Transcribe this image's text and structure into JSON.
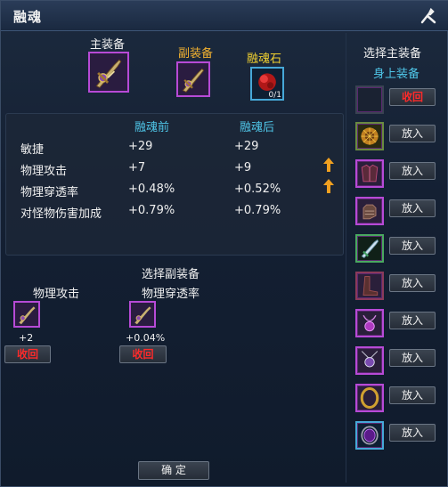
{
  "window": {
    "title": "融魂"
  },
  "top": {
    "main_label": "主装备",
    "sub_label": "副装备",
    "stone_label": "融魂石",
    "stone_count": "0/1"
  },
  "stats": {
    "before_header": "融魂前",
    "after_header": "融魂后",
    "rows": [
      {
        "name": "敏捷",
        "before": "+29",
        "after": "+29",
        "up": false
      },
      {
        "name": "物理攻击",
        "before": "+7",
        "after": "+9",
        "up": true
      },
      {
        "name": "物理穿透率",
        "before": "+0.48%",
        "after": "+0.52%",
        "up": true
      },
      {
        "name": "对怪物伤害加成",
        "before": "+0.79%",
        "after": "+0.79%",
        "up": false
      }
    ]
  },
  "sub_select": {
    "title": "选择副装备",
    "items": [
      {
        "attr": "物理攻击",
        "value": "+2",
        "recall": "收回"
      },
      {
        "attr": "物理穿透率",
        "value": "+0.04%",
        "recall": "收回"
      }
    ]
  },
  "confirm_label": "确 定",
  "right": {
    "title": "选择主装备",
    "subtitle": "身上装备",
    "recall_label": "收回",
    "put_label": "放入",
    "slots": [
      {
        "icon": "amulet-icon"
      },
      {
        "icon": "chest-armor-icon"
      },
      {
        "icon": "gloves-icon"
      },
      {
        "icon": "sword-icon"
      },
      {
        "icon": "boots-icon"
      },
      {
        "icon": "necklace-icon"
      },
      {
        "icon": "pendant-icon"
      },
      {
        "icon": "ring-icon"
      },
      {
        "icon": "gem-ring-icon"
      }
    ]
  },
  "colors": {
    "accent_cyan": "#4fc6e8",
    "gold": "#f0b030",
    "recall_red": "#ff2a2a",
    "slot_purple": "#b74ad6"
  }
}
